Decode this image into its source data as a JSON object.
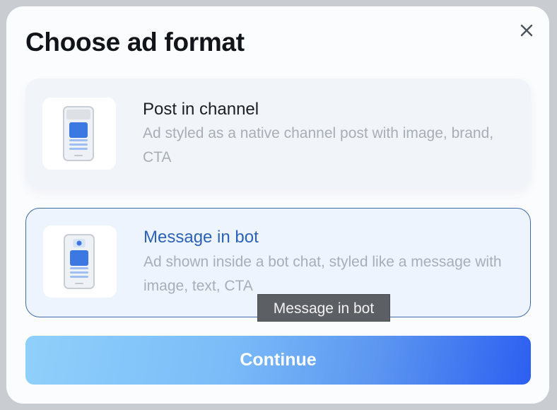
{
  "modal": {
    "title": "Choose ad format",
    "close_icon": "close-icon"
  },
  "options": [
    {
      "title": "Post in channel",
      "description": "Ad styled as a native channel post with image, brand, CTA",
      "icon": "phone-post-icon",
      "selected": false
    },
    {
      "title": "Message in bot",
      "description": "Ad shown inside a bot chat, styled like a message with image, text, CTA",
      "icon": "phone-bot-icon",
      "selected": true
    }
  ],
  "tooltip": {
    "text": "Message in bot"
  },
  "continue_button": {
    "label": "Continue"
  },
  "colors": {
    "accent": "#2c62b8",
    "button_gradient_start": "#8fd0fb",
    "button_gradient_end": "#2c5ff0",
    "selected_border": "#3f6aa8",
    "tooltip_bg": "#5c5f63"
  }
}
